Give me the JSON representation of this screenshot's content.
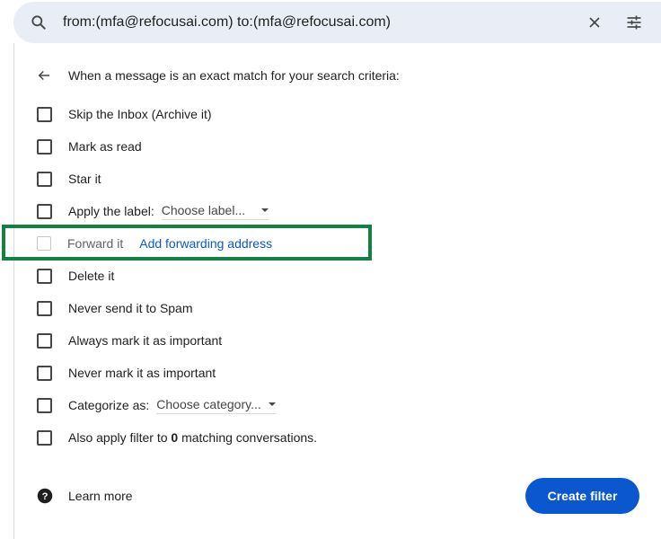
{
  "search": {
    "query": "from:(mfa@refocusai.com) to:(mfa@refocusai.com)",
    "icons": {
      "search": "search-icon",
      "clear": "close-icon",
      "options": "tune-icon"
    }
  },
  "filter": {
    "header": "When a message is an exact match for your search criteria:",
    "options": {
      "skip_inbox": "Skip the Inbox (Archive it)",
      "mark_read": "Mark as read",
      "star": "Star it",
      "apply_label": "Apply the label:",
      "label_placeholder": "Choose label...",
      "forward": "Forward it",
      "add_forwarding": "Add forwarding address",
      "delete": "Delete it",
      "never_spam": "Never send it to Spam",
      "always_important": "Always mark it as important",
      "never_important": "Never mark it as important",
      "categorize": "Categorize as:",
      "category_placeholder": "Choose category...",
      "also_apply_prefix": "Also apply filter to",
      "also_apply_count": "0",
      "also_apply_suffix": "matching conversations."
    }
  },
  "footer": {
    "learn_more": "Learn more",
    "create_filter": "Create filter"
  },
  "colors": {
    "accent": "#0b57d0",
    "highlight": "#138045",
    "searchbar_bg": "#e9eef6"
  }
}
